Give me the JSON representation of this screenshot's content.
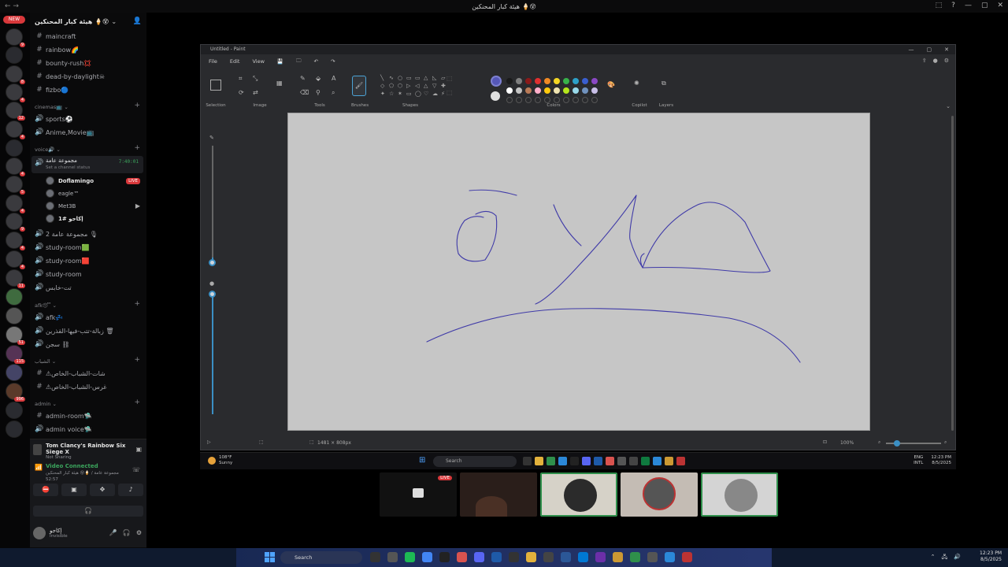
{
  "window": {
    "title": "هيئة كبار المحنكين 🍦😵",
    "controls": [
      "⬚",
      "?",
      "—",
      "▢",
      "✕"
    ]
  },
  "server_rail": {
    "new_label": "NEW",
    "badges": [
      "9",
      "8",
      "4",
      "12",
      "4",
      "4",
      "5",
      "4",
      "9",
      "4",
      "4",
      "11",
      "51",
      "115",
      "996"
    ]
  },
  "server": {
    "name": "هيئة كبار المحنكين 🍦😵"
  },
  "channels": {
    "text": [
      {
        "name": "maincraft"
      },
      {
        "name": "rainbow🌈"
      },
      {
        "name": "bounty-rush💢"
      },
      {
        "name": "dead-by-daylight☠"
      },
      {
        "name": "fizbo🔵"
      }
    ],
    "cat_cinemas": "cinemas📺",
    "cinemas": [
      {
        "name": "sports⚽"
      },
      {
        "name": "Anime,Movie📺"
      }
    ],
    "cat_voice": "voice🔊",
    "active_voice": {
      "name": "مجموعة عامة",
      "status": "Set a channel status",
      "time": "7:40:01"
    },
    "voice_users": [
      {
        "name": "Doflamingo"
      },
      {
        "name": "eagle™"
      },
      {
        "name": "Met3B"
      },
      {
        "name": "إكاجو #1"
      }
    ],
    "live_label": "LIVE",
    "voice_more": [
      {
        "name": "مجموعة عامة 2 🎙"
      },
      {
        "name": "study-room🟩"
      },
      {
        "name": "study-room🟥"
      },
      {
        "name": "study-room"
      },
      {
        "name": "تت-خابس"
      }
    ],
    "cat_afk": "afk😴",
    "afk": [
      {
        "name": "afk💤"
      },
      {
        "name": "زبالة-تتب-فيها-القذرين 🗑"
      },
      {
        "name": "سجن ⛓"
      }
    ],
    "cat_shabab": "الشباب",
    "shabab": [
      {
        "name": "⚠شات-الشباب-الخاص"
      },
      {
        "name": "⚠غرس-الشباب-الخاص"
      }
    ],
    "cat_admin": "admin",
    "admin": [
      {
        "name": "admin-room🛸"
      },
      {
        "name": "admin voice🛸"
      }
    ]
  },
  "panel": {
    "game_title": "Tom Clancy's Rainbow Six Siege X",
    "game_sub": "Not Sharing",
    "vc_title": "Video Connected",
    "vc_sub": "مجموعة عامة / 🍦😵 هيئة كبار المحنكين",
    "vc_time": "52:57",
    "headset": "🎧",
    "user_name": "إكاجو",
    "user_status": "Invisible"
  },
  "paint": {
    "title": "Untitled - Paint",
    "menu": [
      "File",
      "Edit",
      "View"
    ],
    "groups": [
      "Selection",
      "Image",
      "Tools",
      "Brushes",
      "Shapes",
      "Colors",
      "Copilot",
      "Layers"
    ],
    "dimensions": "1481 × 808px",
    "zoom": "100%",
    "palette": [
      "#1a1a1a",
      "#7f7f7f",
      "#8b1a1a",
      "#e03030",
      "#f08a24",
      "#f3d624",
      "#38b24a",
      "#2da0c8",
      "#3a5fd0",
      "#8a48c4",
      "#ffffff",
      "#c3c3c3",
      "#b97a57",
      "#ffaec9",
      "#ffc90e",
      "#efe4b0",
      "#b5e61d",
      "#99d9ea",
      "#7092be",
      "#c8bfe7"
    ]
  },
  "inner_taskbar": {
    "weather_temp": "108°F",
    "weather_desc": "Sunny",
    "search": "Search",
    "lang": "ENG",
    "lang2": "INTL",
    "time": "12:23 PM",
    "date": "8/5/2025"
  },
  "tiles": {
    "live_label": "LIVE"
  },
  "os_taskbar": {
    "search": "Search",
    "time": "12:23 PM",
    "date": "8/5/2025"
  }
}
